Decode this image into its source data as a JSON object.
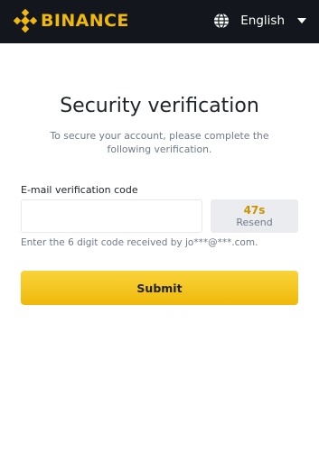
{
  "header": {
    "brand": "BINANCE",
    "language_label": "English",
    "icons": {
      "logo": "binance-diamond-logo",
      "language": "globe-icon",
      "dropdown": "caret-down-icon"
    }
  },
  "main": {
    "title": "Security verification",
    "subtitle": "To secure your account, please complete the following verification.",
    "email_code": {
      "label": "E-mail verification code",
      "value": "",
      "placeholder": ""
    },
    "resend": {
      "countdown": "47s",
      "label": "Resend"
    },
    "hint": "Enter the 6 digit code received by jo***@***.com.",
    "submit_label": "Submit"
  },
  "colors": {
    "brand_yellow": "#f0b90b",
    "header_bg": "#13171d",
    "text_primary": "#1e2329",
    "text_secondary": "#707a8a",
    "countdown": "#c99400"
  }
}
